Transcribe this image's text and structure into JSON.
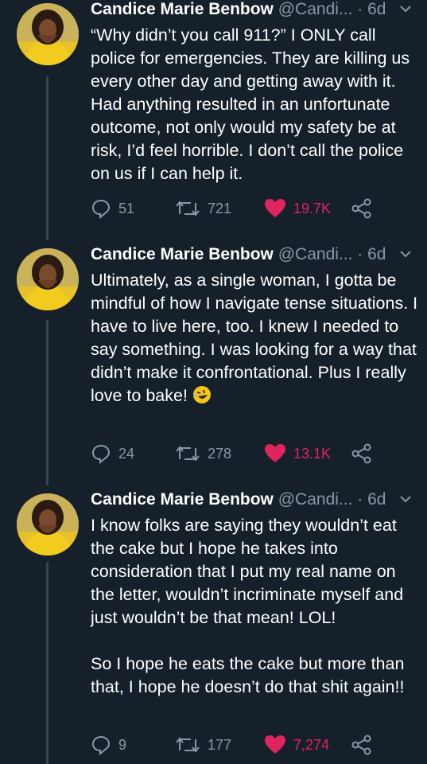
{
  "colors": {
    "background": "#15202b",
    "text": "#ffffff",
    "muted": "#8899a6",
    "like": "#e0245e",
    "thread_line": "#38444d"
  },
  "tweets": [
    {
      "name": "Candice Marie Benbow",
      "handle": "@Candi...",
      "time": "· 6d",
      "text": "“Why didn’t you call 911?” I ONLY call police for emergencies. They are killing us every other day and getting away with it. Had anything resulted in an unfortunate outcome, not only would my safety be at risk, I’d feel horrible. I don’t call the police on us if I can help it.",
      "replies": "51",
      "retweets": "721",
      "likes": "19.7K"
    },
    {
      "name": "Candice Marie Benbow",
      "handle": "@Candi...",
      "time": "· 6d",
      "text": "Ultimately, as a single woman, I gotta be mindful of how I navigate tense situations. I have to live here, too. I knew I needed to say something. I was looking for a way that didn’t make it confrontational. Plus I really love to bake!",
      "emoji": "rolling-on-floor-laughing-emoji",
      "replies": "24",
      "retweets": "278",
      "likes": "13.1K"
    },
    {
      "name": "Candice Marie Benbow",
      "handle": "@Candi...",
      "time": "· 6d",
      "text": "I know folks are saying they wouldn’t eat the cake but I hope he takes into consideration that I put my real name on the letter, wouldn’t incriminate myself and just wouldn’t be that mean! LOL!\n\nSo I hope he eats the cake but more than that, I hope he doesn’t do that shit again!!",
      "replies": "9",
      "retweets": "177",
      "likes": "7,274"
    }
  ]
}
